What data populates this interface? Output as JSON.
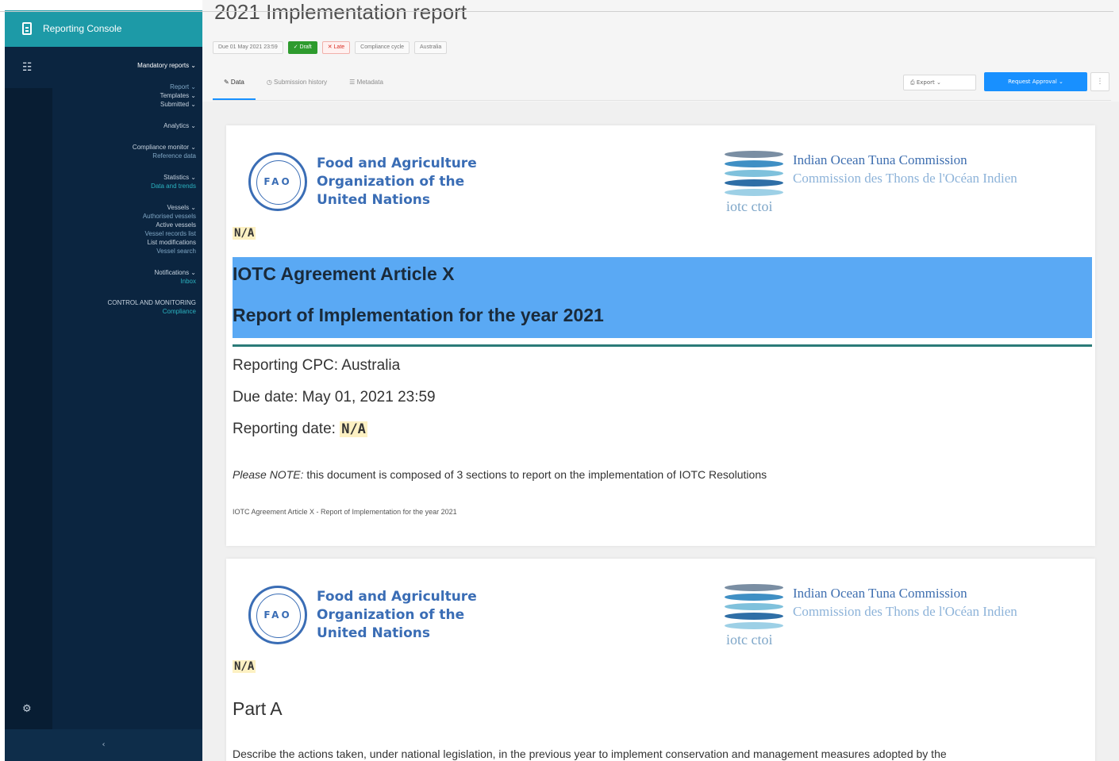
{
  "sidebar": {
    "app_title": "Reporting Console",
    "menu": [
      {
        "label": "Mandatory reports ⌄",
        "style": "active"
      },
      {
        "label": "",
        "style": "gap"
      },
      {
        "label": "Report ⌄",
        "style": "sub"
      },
      {
        "label": "Templates ⌄",
        "style": "item"
      },
      {
        "label": "Submitted ⌄",
        "style": "item"
      },
      {
        "label": "",
        "style": "gap"
      },
      {
        "label": "Analytics ⌄",
        "style": "item"
      },
      {
        "label": "",
        "style": "gap"
      },
      {
        "label": "Compliance monitor ⌄",
        "style": "item"
      },
      {
        "label": "Reference data",
        "style": "sub"
      },
      {
        "label": "",
        "style": "gap"
      },
      {
        "label": "Statistics ⌄",
        "style": "item"
      },
      {
        "label": "Data and trends",
        "style": "link"
      },
      {
        "label": "",
        "style": "gap"
      },
      {
        "label": "Vessels ⌄",
        "style": "item"
      },
      {
        "label": "Authorised vessels",
        "style": "sub"
      },
      {
        "label": "Active vessels",
        "style": "item"
      },
      {
        "label": "Vessel records list",
        "style": "sub"
      },
      {
        "label": "List modifications",
        "style": "item"
      },
      {
        "label": "Vessel search",
        "style": "sub"
      },
      {
        "label": "",
        "style": "gap"
      },
      {
        "label": "Notifications ⌄",
        "style": "item"
      },
      {
        "label": "Inbox",
        "style": "link"
      },
      {
        "label": "",
        "style": "gap"
      },
      {
        "label": "CONTROL AND MONITORING",
        "style": "item"
      },
      {
        "label": "Compliance",
        "style": "link"
      }
    ],
    "collapse_glyph": "‹"
  },
  "header": {
    "title": "2021 Implementation report",
    "tags": [
      {
        "label": "Due 01 May 2021 23:59",
        "kind": "default"
      },
      {
        "label": "✓ Draft",
        "kind": "green"
      },
      {
        "label": "✕ Late",
        "kind": "red"
      },
      {
        "label": "Compliance cycle",
        "kind": "default"
      },
      {
        "label": "Australia",
        "kind": "default"
      }
    ],
    "tabs": [
      {
        "label": "✎ Data",
        "active": true
      },
      {
        "label": "◷ Submission history",
        "active": false
      },
      {
        "label": "☰ Metadata",
        "active": false
      }
    ],
    "export_label": "⎙ Export ⌄",
    "primary_label": "Request Approval ⌄",
    "more_label": "⋮"
  },
  "fao": {
    "seal": "FAO",
    "lines": [
      "Food and Agriculture",
      "Organization of the",
      "United Nations"
    ]
  },
  "iotc": {
    "caption": "iotc ctoi",
    "en": "Indian Ocean Tuna Commission",
    "fr": "Commission des Thons de l'Océan Indien"
  },
  "card1": {
    "na": "N/A",
    "banner_line1": "IOTC Agreement Article X",
    "banner_line2": "Report of Implementation for the year 2021",
    "cpc_label": "Reporting CPC: Australia",
    "due_label": "Due date: May 01, 2021 23:59",
    "date_label": "Reporting date: ",
    "date_value": "N/A",
    "note_prefix": "Please NOTE:",
    "note_text": " this document is composed of 3 sections to report on the implementation of IOTC Resolutions",
    "footer_ref": "IOTC Agreement Article X - Report of Implementation for the year 2021"
  },
  "card2": {
    "na": "N/A",
    "part_title": "Part A",
    "part_desc": "Describe the actions taken, under national legislation, in the previous year to implement conservation and management measures adopted by the"
  },
  "colors": {
    "sidebar": "#0b2540",
    "sidebar_header": "#1d9aa7",
    "primary": "#1890ff",
    "banner": "#5aa9f4",
    "highlight": "#fdf1c3"
  }
}
